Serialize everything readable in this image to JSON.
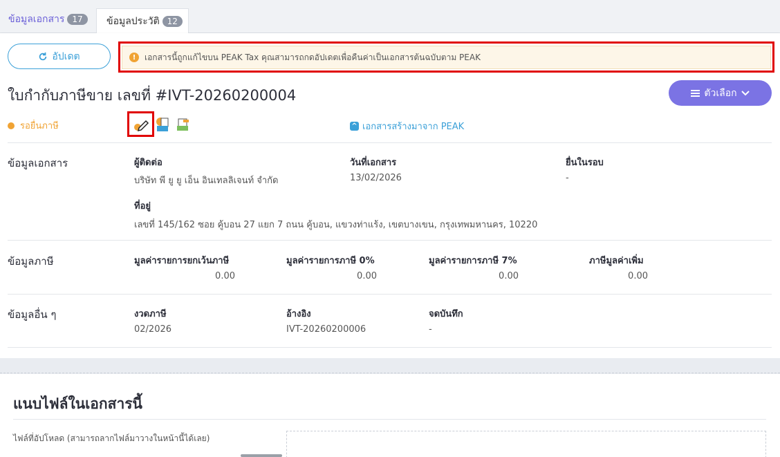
{
  "tabs": [
    {
      "label": "ข้อมูลเอกสาร",
      "count": "17"
    },
    {
      "label": "ข้อมูลประวัติ",
      "count": "12"
    }
  ],
  "toolbar": {
    "refresh_label": "อัปเดต",
    "options_label": "ตัวเลือก"
  },
  "alert": {
    "text": "เอกสารนี้ถูกแก้ไขบน PEAK Tax คุณสามารถกดอัปเดตเพื่อคืนค่าเป็นเอกสารต้นฉบับตาม PEAK"
  },
  "document": {
    "title": "ใบกำกับภาษีขาย เลขที่ #IVT-20260200004",
    "status": "รอยื่นภาษี",
    "source_link": "เอกสารสร้างมาจาก PEAK"
  },
  "doc_info": {
    "section": "ข้อมูลเอกสาร",
    "contact_label": "ผู้ติดต่อ",
    "contact_value": "บริษัท พี ยู ยู เอ็น อินเทลลิเจนท์ จำกัด",
    "date_label": "วันที่เอกสาร",
    "date_value": "13/02/2026",
    "period_label": "ยื่นในรอบ",
    "period_value": "-",
    "address_label": "ที่อยู่",
    "address_value": "เลขที่ 145/162 ซอย คู้บอน 27 แยก 7 ถนน คู้บอน, แขวงท่าแร้ง, เขตบางเขน, กรุงเทพมหานคร, 10220"
  },
  "tax_info": {
    "section": "ข้อมูลภาษี",
    "exempt_label": "มูลค่ารายการยกเว้นภาษี",
    "exempt_value": "0.00",
    "zero_label": "มูลค่ารายการภาษี 0%",
    "zero_value": "0.00",
    "seven_label": "มูลค่ารายการภาษี 7%",
    "seven_value": "0.00",
    "vat_label": "ภาษีมูลค่าเพิ่ม",
    "vat_value": "0.00"
  },
  "other_info": {
    "section": "ข้อมูลอื่น ๆ",
    "tax_period_label": "งวดภาษี",
    "tax_period_value": "02/2026",
    "reference_label": "อ้างอิง",
    "reference_value": "IVT-20260200006",
    "note_label": "จดบันทึก",
    "note_value": "-"
  },
  "attachments": {
    "title": "แนบไฟล์ในเอกสารนี้",
    "upload_label": "ไฟล์ที่อัปโหลด (สามารถลากไฟล์มาวางในหน้านี้ได้เลย)"
  },
  "icons": [
    "refresh-icon",
    "info-icon",
    "menu-icon",
    "chevron-down-icon",
    "edit-icon",
    "tiv-icon",
    "wth-icon",
    "peak-logo-icon"
  ],
  "colors": {
    "accent": "#7b73e4",
    "link": "#3ba0d8",
    "pending": "#f0a334",
    "highlight": "#e00000"
  }
}
